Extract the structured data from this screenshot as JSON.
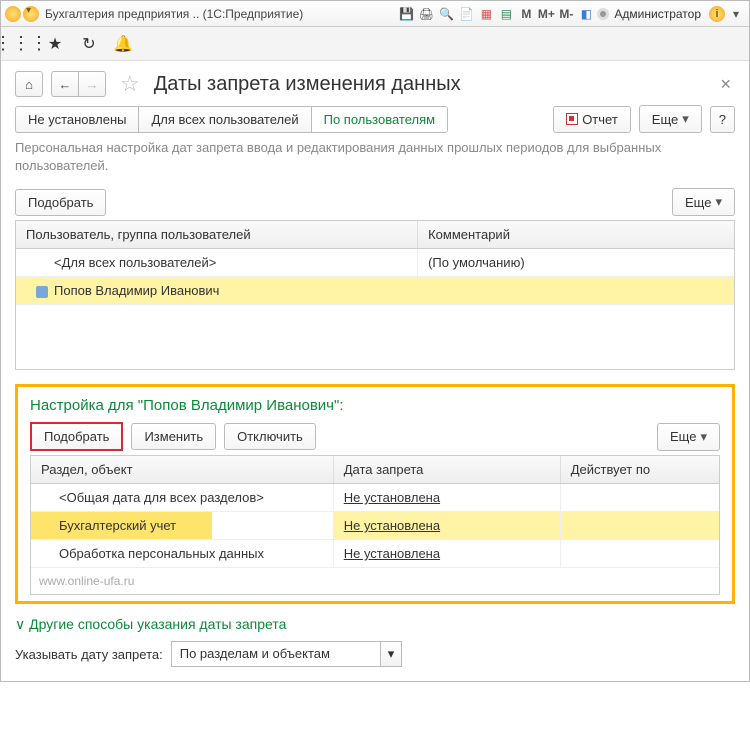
{
  "titlebar": {
    "app_title": "Бухгалтерия предприятия .. (1С:Предприятие)",
    "admin_label": "Администратор"
  },
  "page": {
    "title": "Даты запрета изменения данных",
    "description": "Персональная настройка дат запрета ввода и редактирования данных прошлых периодов для выбранных пользователей.",
    "tabs": [
      "Не установлены",
      "Для всех пользователей",
      "По пользователям"
    ],
    "active_tab_index": 2,
    "report_btn": "Отчет",
    "more_btn": "Еще",
    "help_btn": "?",
    "pick_btn": "Подобрать"
  },
  "users_table": {
    "headers": [
      "Пользователь, группа пользователей",
      "Комментарий"
    ],
    "rows": [
      {
        "user": "<Для всех пользователей>",
        "comment": "(По умолчанию)",
        "selected": false,
        "has_icon": false
      },
      {
        "user": "Попов Владимир Иванович",
        "comment": "",
        "selected": true,
        "has_icon": true
      }
    ]
  },
  "detail": {
    "title": "Настройка для \"Попов Владимир Иванович\":",
    "buttons": {
      "pick": "Подобрать",
      "edit": "Изменить",
      "disable": "Отключить",
      "more": "Еще"
    },
    "table": {
      "headers": [
        "Раздел, объект",
        "Дата запрета",
        "Действует по"
      ],
      "rows": [
        {
          "section": "<Общая дата для всех разделов>",
          "date": "Не установлена",
          "until": "",
          "selected": false
        },
        {
          "section": "Бухгалтерский учет",
          "date": "Не установлена",
          "until": "",
          "selected": true
        },
        {
          "section": "Обработка персональных данных",
          "date": "Не установлена",
          "until": "",
          "selected": false
        }
      ]
    },
    "watermark": "www.online-ufa.ru"
  },
  "footer": {
    "expander": "Другие способы указания даты запрета",
    "field_label": "Указывать дату запрета:",
    "field_value": "По разделам и объектам"
  }
}
